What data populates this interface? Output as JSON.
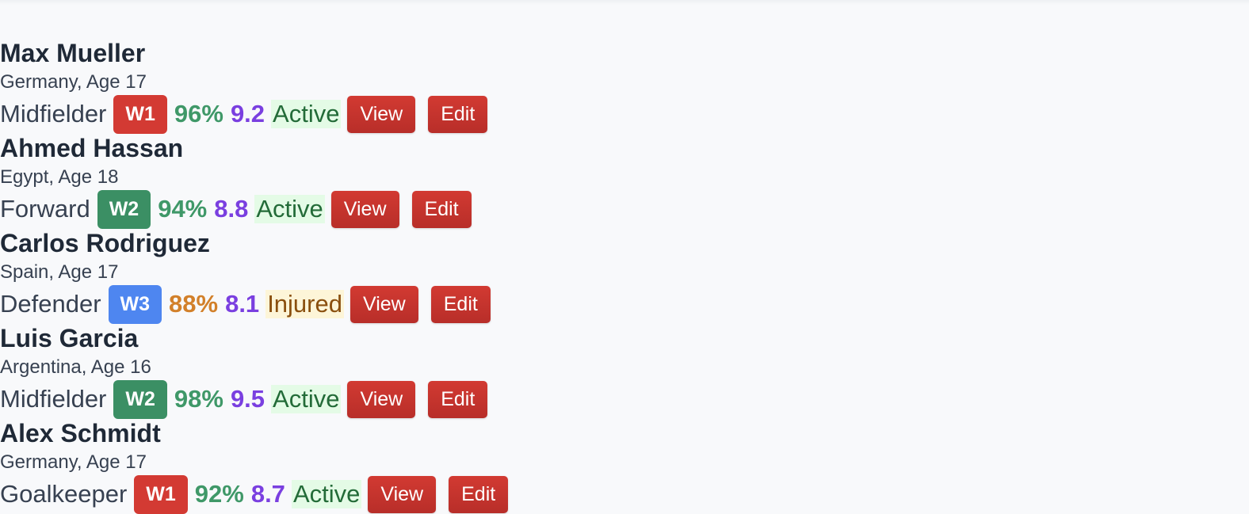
{
  "players": [
    {
      "name": "Max Mueller",
      "details": "Germany, Age 17",
      "position": "Midfielder",
      "week": "W1",
      "week_color": "#d33a33",
      "percent": "96%",
      "percent_color": "#3f9868",
      "rating": "9.2",
      "status": "Active",
      "view_label": "View",
      "edit_label": "Edit"
    },
    {
      "name": "Ahmed Hassan",
      "details": "Egypt, Age 18",
      "position": "Forward",
      "week": "W2",
      "week_color": "#3b8f64",
      "percent": "94%",
      "percent_color": "#3f9868",
      "rating": "8.8",
      "status": "Active",
      "view_label": "View",
      "edit_label": "Edit"
    },
    {
      "name": "Carlos Rodriguez",
      "details": "Spain, Age 17",
      "position": "Defender",
      "week": "W3",
      "week_color": "#4e86f0",
      "percent": "88%",
      "percent_color": "#d2802a",
      "rating": "8.1",
      "status": "Injured",
      "view_label": "View",
      "edit_label": "Edit"
    },
    {
      "name": "Luis Garcia",
      "details": "Argentina, Age 16",
      "position": "Midfielder",
      "week": "W2",
      "week_color": "#3b8f64",
      "percent": "98%",
      "percent_color": "#3f9868",
      "rating": "9.5",
      "status": "Active",
      "view_label": "View",
      "edit_label": "Edit"
    },
    {
      "name": "Alex Schmidt",
      "details": "Germany, Age 17",
      "position": "Goalkeeper",
      "week": "W1",
      "week_color": "#d33a33",
      "percent": "92%",
      "percent_color": "#3f9868",
      "rating": "8.7",
      "status": "Active",
      "view_label": "View",
      "edit_label": "Edit"
    }
  ]
}
